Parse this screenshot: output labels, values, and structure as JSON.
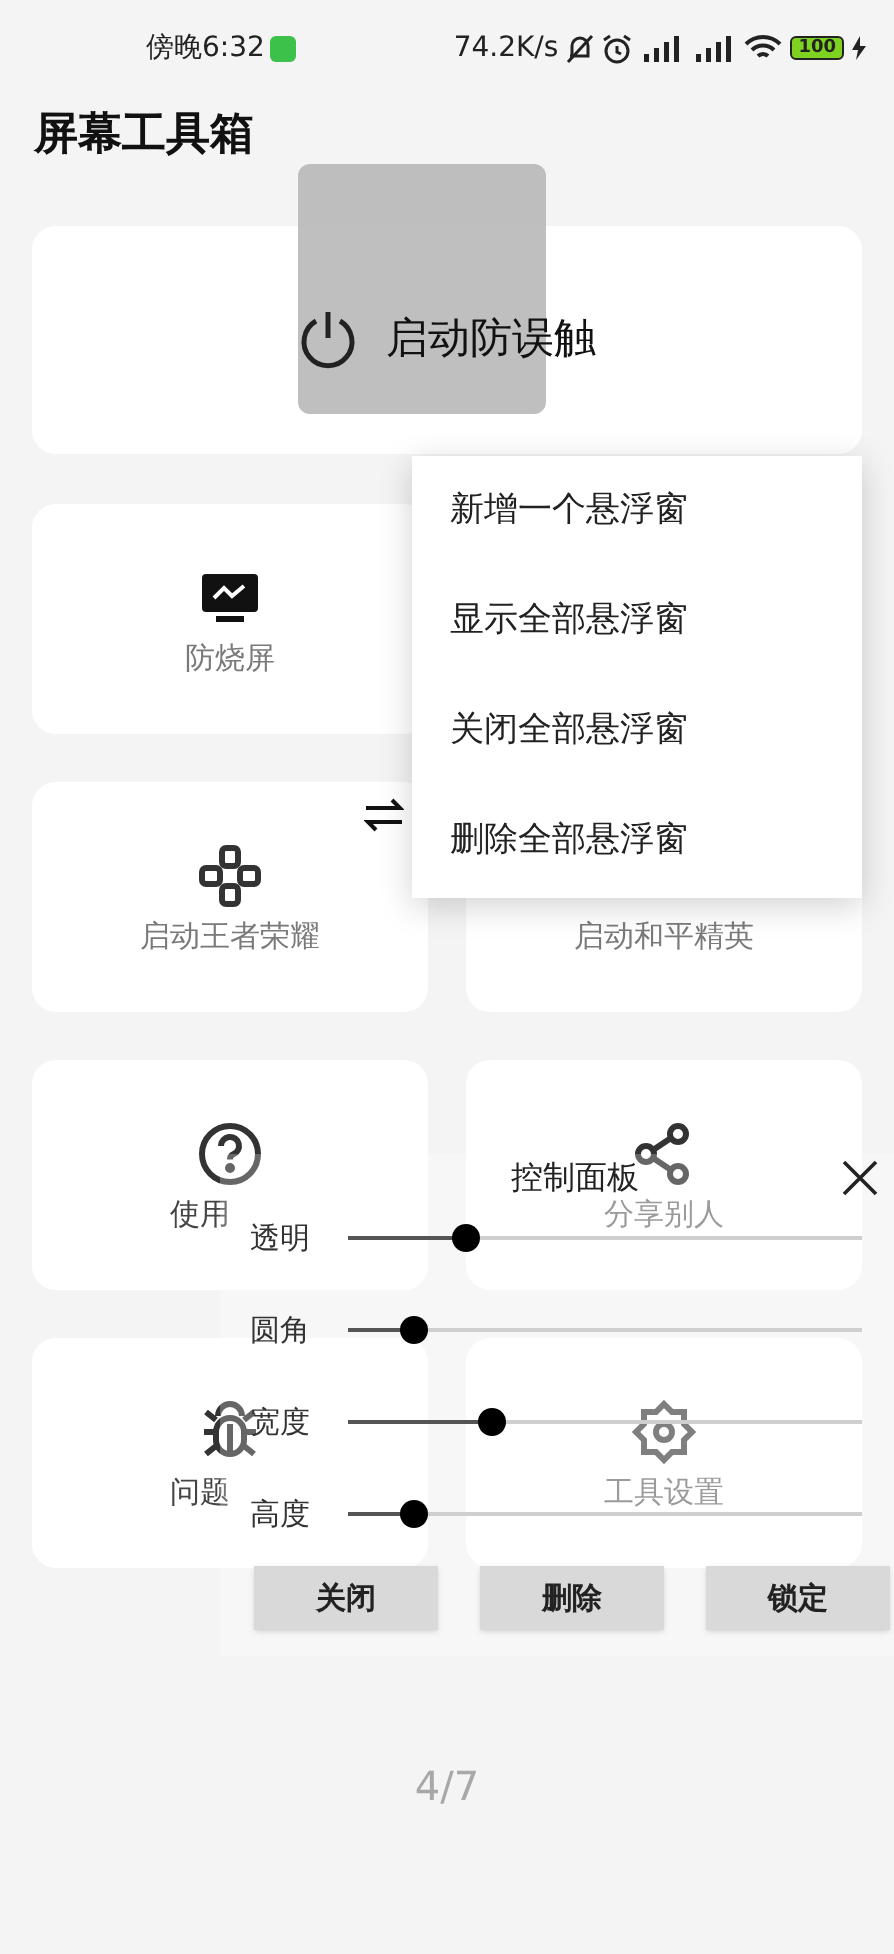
{
  "status_bar": {
    "time": "傍晚6:32",
    "speed": "74.2K/s",
    "battery": "100"
  },
  "title": "屏幕工具箱",
  "main_button": {
    "label": "启动防误触"
  },
  "tiles": [
    {
      "kind": "monitor",
      "label": "防烧屏",
      "covered": false
    },
    {
      "kind": "gamepad",
      "label": "启动王者荣耀",
      "covered": false
    },
    {
      "kind": "blank",
      "label": "启动和平精英",
      "covered": false
    },
    {
      "kind": "help",
      "label": "使用",
      "covered": true
    },
    {
      "kind": "share",
      "label": "分享别人",
      "covered": false
    },
    {
      "kind": "bug",
      "label": "问题",
      "covered": true
    },
    {
      "kind": "gear",
      "label": "工具设置",
      "covered": false
    }
  ],
  "menu": [
    "新增一个悬浮窗",
    "显示全部悬浮窗",
    "关闭全部悬浮窗",
    "删除全部悬浮窗"
  ],
  "control_panel": {
    "title": "控制面板",
    "sliders": [
      {
        "label": "透明",
        "level": 0.23
      },
      {
        "label": "圆角",
        "level": 0.13
      },
      {
        "label": "宽度",
        "level": 0.28
      },
      {
        "label": "高度",
        "level": 0.13
      }
    ],
    "buttons": [
      "关闭",
      "删除",
      "锁定"
    ]
  },
  "page_indicator": "4/7"
}
